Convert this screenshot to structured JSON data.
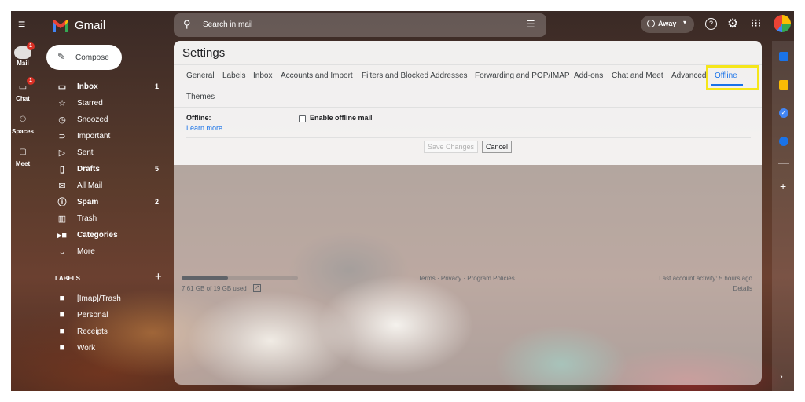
{
  "app": {
    "name": "Gmail"
  },
  "search": {
    "placeholder": "Search in mail"
  },
  "status": {
    "label": "Away"
  },
  "rail": [
    {
      "label": "Mail",
      "badge": "1"
    },
    {
      "label": "Chat",
      "badge": "1"
    },
    {
      "label": "Spaces"
    },
    {
      "label": "Meet"
    }
  ],
  "compose": {
    "label": "Compose"
  },
  "nav": [
    {
      "label": "Inbox",
      "count": "1",
      "bold": true,
      "icon": "inbox-icon"
    },
    {
      "label": "Starred",
      "icon": "star-icon"
    },
    {
      "label": "Snoozed",
      "icon": "clock-icon"
    },
    {
      "label": "Important",
      "icon": "important-icon"
    },
    {
      "label": "Sent",
      "icon": "send-icon"
    },
    {
      "label": "Drafts",
      "count": "5",
      "bold": true,
      "icon": "draft-icon"
    },
    {
      "label": "All Mail",
      "icon": "all-mail-icon"
    },
    {
      "label": "Spam",
      "count": "2",
      "bold": true,
      "icon": "spam-icon"
    },
    {
      "label": "Trash",
      "icon": "trash-icon"
    },
    {
      "label": "Categories",
      "bold": true,
      "icon": "label-icon"
    },
    {
      "label": "More",
      "icon": "chevron-down-icon"
    }
  ],
  "labels": {
    "heading": "LABELS",
    "items": [
      "[Imap]/Trash",
      "Personal",
      "Receipts",
      "Work"
    ]
  },
  "settings": {
    "title": "Settings",
    "tabs": [
      "General",
      "Labels",
      "Inbox",
      "Accounts and Import",
      "Filters and Blocked Addresses",
      "Forwarding and POP/IMAP",
      "Add-ons",
      "Chat and Meet",
      "Advanced",
      "Offline",
      "Themes"
    ],
    "active_tab": "Offline",
    "offline_label": "Offline:",
    "learn_more": "Learn more",
    "enable_label": "Enable offline mail",
    "save_label": "Save Changes",
    "cancel_label": "Cancel"
  },
  "footer": {
    "storage": "7.61 GB of 19 GB used",
    "storage_fraction": 0.4,
    "links": "Terms · Privacy · Program Policies",
    "activity": "Last account activity: 5 hours ago",
    "details": "Details"
  },
  "colors": {
    "highlight": "#f5e61a",
    "accent": "#1a73e8",
    "gmail_red": "#ea4335"
  }
}
